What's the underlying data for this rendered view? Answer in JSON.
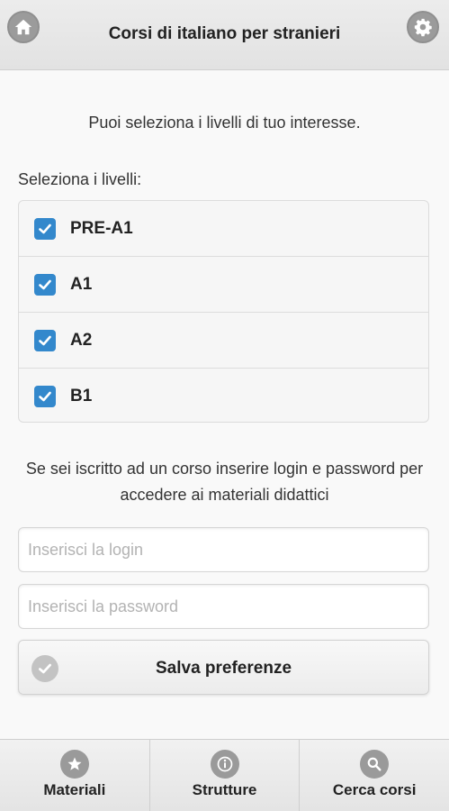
{
  "header": {
    "title": "Corsi di italiano per stranieri",
    "home_icon": "home-icon",
    "settings_icon": "gear-icon"
  },
  "intro": {
    "text": "Puoi seleziona i livelli di tuo interesse."
  },
  "levels": {
    "label": "Seleziona i livelli:",
    "items": [
      {
        "label": "PRE-A1",
        "checked": true
      },
      {
        "label": "A1",
        "checked": true
      },
      {
        "label": "A2",
        "checked": true
      },
      {
        "label": "B1",
        "checked": true
      }
    ]
  },
  "login": {
    "note": "Se sei iscritto ad un corso inserire login e password per accedere ai materiali didattici",
    "login_placeholder": "Inserisci la login",
    "password_placeholder": "Inserisci la password",
    "login_value": "",
    "password_value": ""
  },
  "save": {
    "label": "Salva preferenze",
    "icon": "check-circle-icon"
  },
  "footer": {
    "items": [
      {
        "label": "Materiali",
        "icon": "star-icon"
      },
      {
        "label": "Strutture",
        "icon": "info-icon"
      },
      {
        "label": "Cerca corsi",
        "icon": "search-icon"
      }
    ]
  },
  "colors": {
    "accent": "#3388cc",
    "header_bg": "#e6e6e6",
    "icon_gray": "#9a9a9a"
  }
}
